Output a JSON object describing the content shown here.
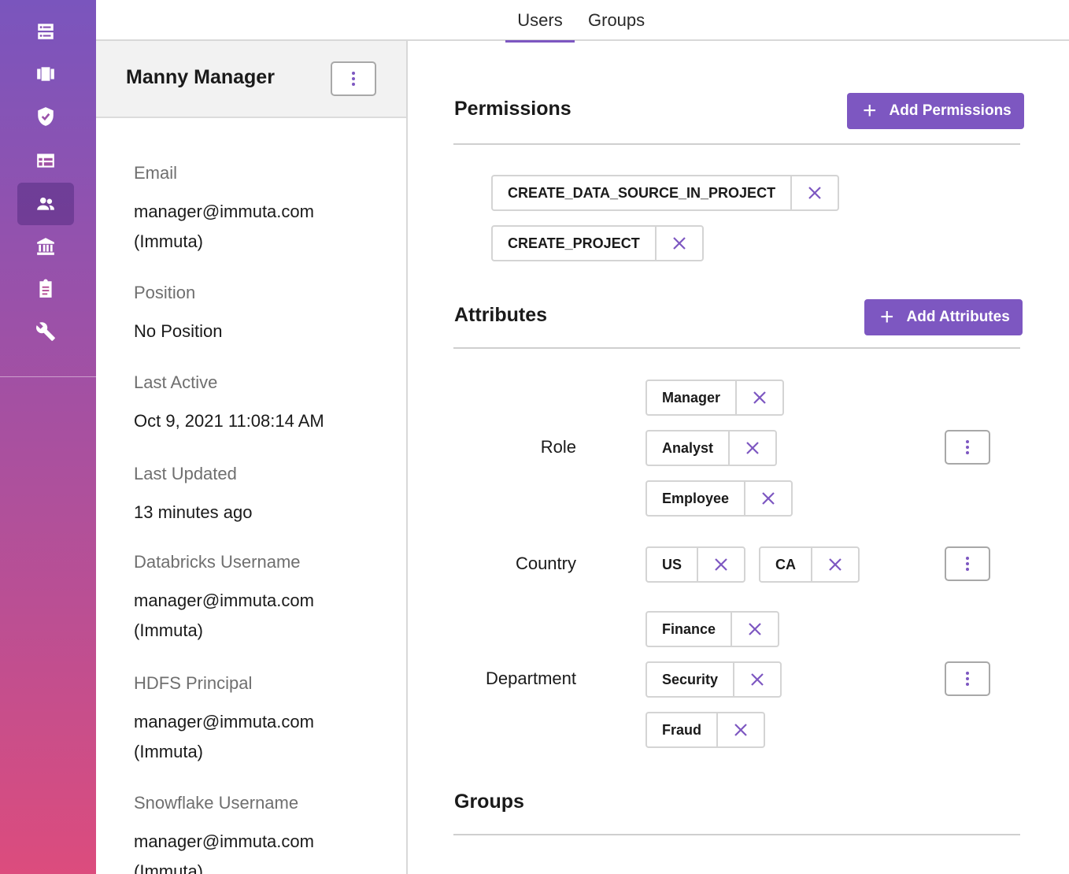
{
  "sidebar": {
    "items": [
      {
        "icon": "server-icon",
        "name": "data-sources"
      },
      {
        "icon": "projects-icon",
        "name": "projects"
      },
      {
        "icon": "shield-check-icon",
        "name": "policies"
      },
      {
        "icon": "table-icon",
        "name": "catalog"
      },
      {
        "icon": "people-icon",
        "name": "people",
        "active": true
      },
      {
        "icon": "bank-icon",
        "name": "governance"
      },
      {
        "icon": "clipboard-icon",
        "name": "audit"
      },
      {
        "icon": "wrench-icon",
        "name": "settings"
      }
    ]
  },
  "tabs": {
    "users": "Users",
    "groups": "Groups"
  },
  "profile": {
    "name": "Manny Manager",
    "fields": [
      {
        "label": "Email",
        "value": "manager@immuta.com (Immuta)"
      },
      {
        "label": "Position",
        "value": "No Position"
      },
      {
        "label": "Last Active",
        "value": "Oct 9, 2021 11:08:14 AM"
      },
      {
        "label": "Last Updated",
        "value": "13 minutes ago"
      },
      {
        "label": "Databricks Username",
        "value": "manager@immuta.com (Immuta)"
      },
      {
        "label": "HDFS Principal",
        "value": "manager@immuta.com (Immuta)"
      },
      {
        "label": "Snowflake Username",
        "value": "manager@immuta.com (Immuta)"
      }
    ]
  },
  "permissions": {
    "title": "Permissions",
    "add_label": "Add Permissions",
    "items": [
      "CREATE_DATA_SOURCE_IN_PROJECT",
      "CREATE_PROJECT"
    ]
  },
  "attributes": {
    "title": "Attributes",
    "add_label": "Add Attributes",
    "groups": [
      {
        "name": "Role",
        "values": [
          "Manager",
          "Analyst",
          "Employee"
        ]
      },
      {
        "name": "Country",
        "values": [
          "US",
          "CA"
        ]
      },
      {
        "name": "Department",
        "values": [
          "Finance",
          "Security",
          "Fraud"
        ]
      }
    ]
  },
  "groups_section": {
    "title": "Groups"
  },
  "colors": {
    "accent": "#7d57c1",
    "sidebar_top": "#7a55bd",
    "sidebar_bottom": "#dc4c7d"
  }
}
